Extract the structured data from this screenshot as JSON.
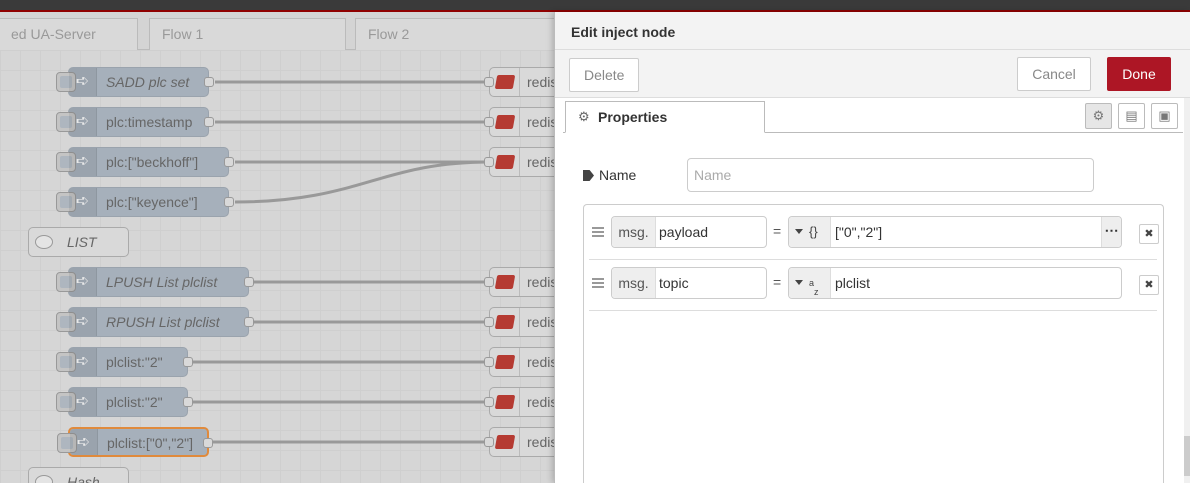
{
  "workspace": {
    "tabs": [
      "ed UA-Server",
      "Flow 1",
      "Flow 2"
    ],
    "nodes": [
      {
        "label": "SADD plc set",
        "italic": true
      },
      {
        "label": "plc:timestamp",
        "italic": false
      },
      {
        "label": "plc:[\"beckhoff\"]",
        "italic": false
      },
      {
        "label": "plc:[\"keyence\"]",
        "italic": false
      },
      {
        "label": "LPUSH List plclist",
        "italic": true
      },
      {
        "label": "RPUSH List plclist",
        "italic": true
      },
      {
        "label": "plclist:\"2\"",
        "italic": false
      },
      {
        "label": "plclist:\"2\"",
        "italic": false
      },
      {
        "label": "plclist:[\"0\",\"2\"]",
        "italic": false
      }
    ],
    "comments": [
      "LIST",
      "Hash"
    ],
    "redis_label": "redis"
  },
  "tray": {
    "title": "Edit inject node",
    "delete_label": "Delete",
    "cancel_label": "Cancel",
    "done_label": "Done",
    "properties_tab": "Properties",
    "name_label": "Name",
    "name_placeholder": "Name",
    "name_value": "",
    "msg_prefix": "msg.",
    "equals": "=",
    "rows": [
      {
        "property": "payload",
        "type_icon": "json-icon",
        "value": "[\"0\",\"2\"]",
        "expand": "⋯"
      },
      {
        "property": "topic",
        "type_icon": "string-icon",
        "value": "plclist"
      }
    ],
    "remove_glyph": "✖"
  },
  "colors": {
    "accent_red": "#ad1625",
    "node_grey": "#a6b0bb",
    "selected_outline": "#e08a3c"
  }
}
